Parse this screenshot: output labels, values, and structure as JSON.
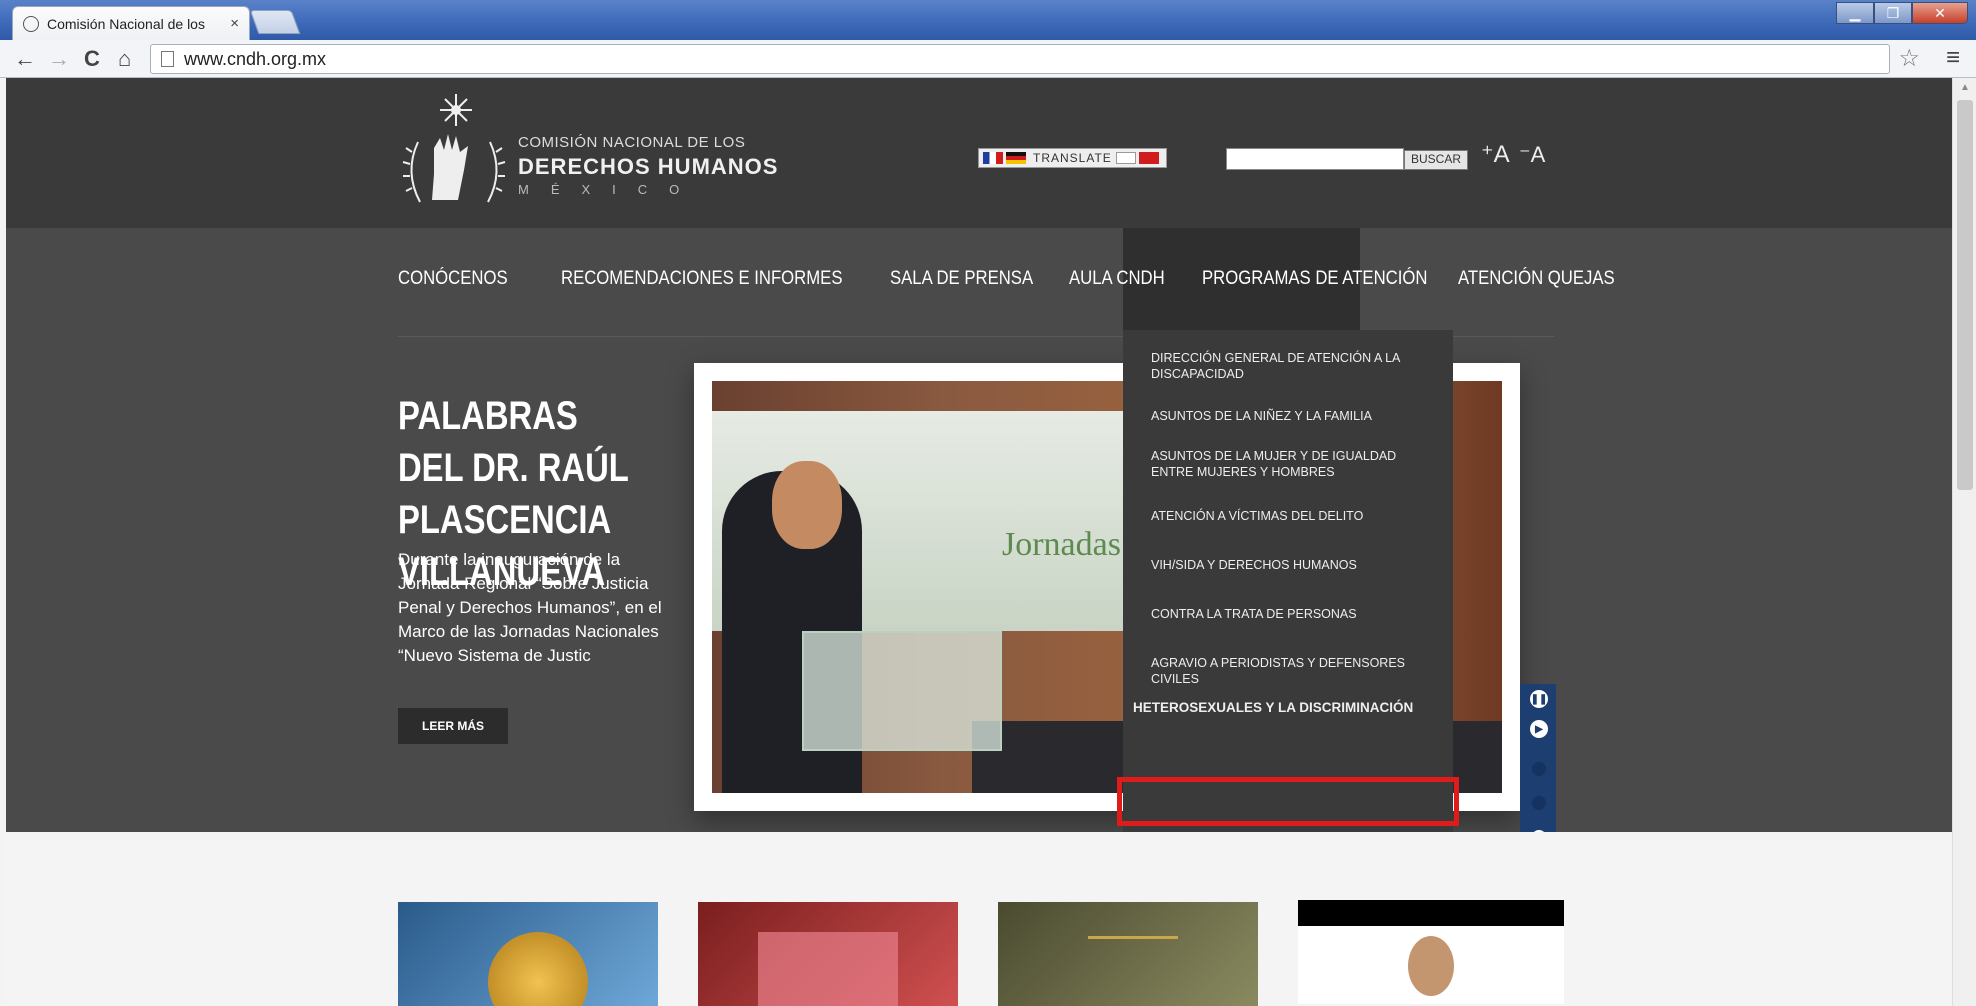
{
  "browser": {
    "tab_title": "Comisión Nacional de los",
    "tab_close": "×",
    "url": "www.cndh.org.mx",
    "back": "←",
    "forward": "→",
    "reload": "C",
    "home": "⌂",
    "star": "☆",
    "menu": "≡",
    "minimize": "▁",
    "maximize": "❐",
    "close": "✕"
  },
  "logo": {
    "line1": "COMISIÓN NACIONAL DE LOS",
    "line2": "DERECHOS HUMANOS",
    "line3": "MÉXICO"
  },
  "header": {
    "translate_label": "TRANSLATE",
    "search_button": "BUSCAR",
    "font_increase": "⁺A",
    "font_decrease": "⁻A"
  },
  "nav": [
    "CONÓCENOS",
    "RECOMENDACIONES E INFORMES",
    "SALA DE PRENSA",
    "AULA CNDH",
    "PROGRAMAS DE ATENCIÓN",
    "ATENCIÓN QUEJAS"
  ],
  "dropdown": [
    "DIRECCIÓN GENERAL DE ATENCIÓN A LA DISCAPACIDAD",
    "ASUNTOS DE LA NIÑEZ Y LA FAMILIA",
    "ASUNTOS DE LA MUJER Y DE IGUALDAD ENTRE MUJERES Y HOMBRES",
    "ATENCIÓN A VÍCTIMAS DEL DELITO",
    "VIH/SIDA Y DERECHOS HUMANOS",
    "CONTRA LA TRATA DE PERSONAS",
    "AGRAVIO A PERIODISTAS Y DEFENSORES CIVILES",
    "HETEROSEXUALES Y LA DISCRIMINACIÓN"
  ],
  "hero": {
    "title": "PALABRAS DEL DR. RAÚL PLASCENCIA VILLANUEVA",
    "text": "Durante la inauguración de la Jornada Regional “Sobre Justicia Penal y Derechos Humanos”, en el Marco de las Jornadas Nacionales “Nuevo Sistema de Justic",
    "button": "LEER MÁS",
    "slide_banner_text": "Jornadas"
  },
  "slider": {
    "pause": "❚❚",
    "play": "▶"
  },
  "colors": {
    "header_bg": "#3a3a3a",
    "nav_bg": "#4a4a4a",
    "dropdown_bg": "#3a3a3a",
    "highlight": "#e01b1b",
    "slider_side": "#1c3e70"
  }
}
